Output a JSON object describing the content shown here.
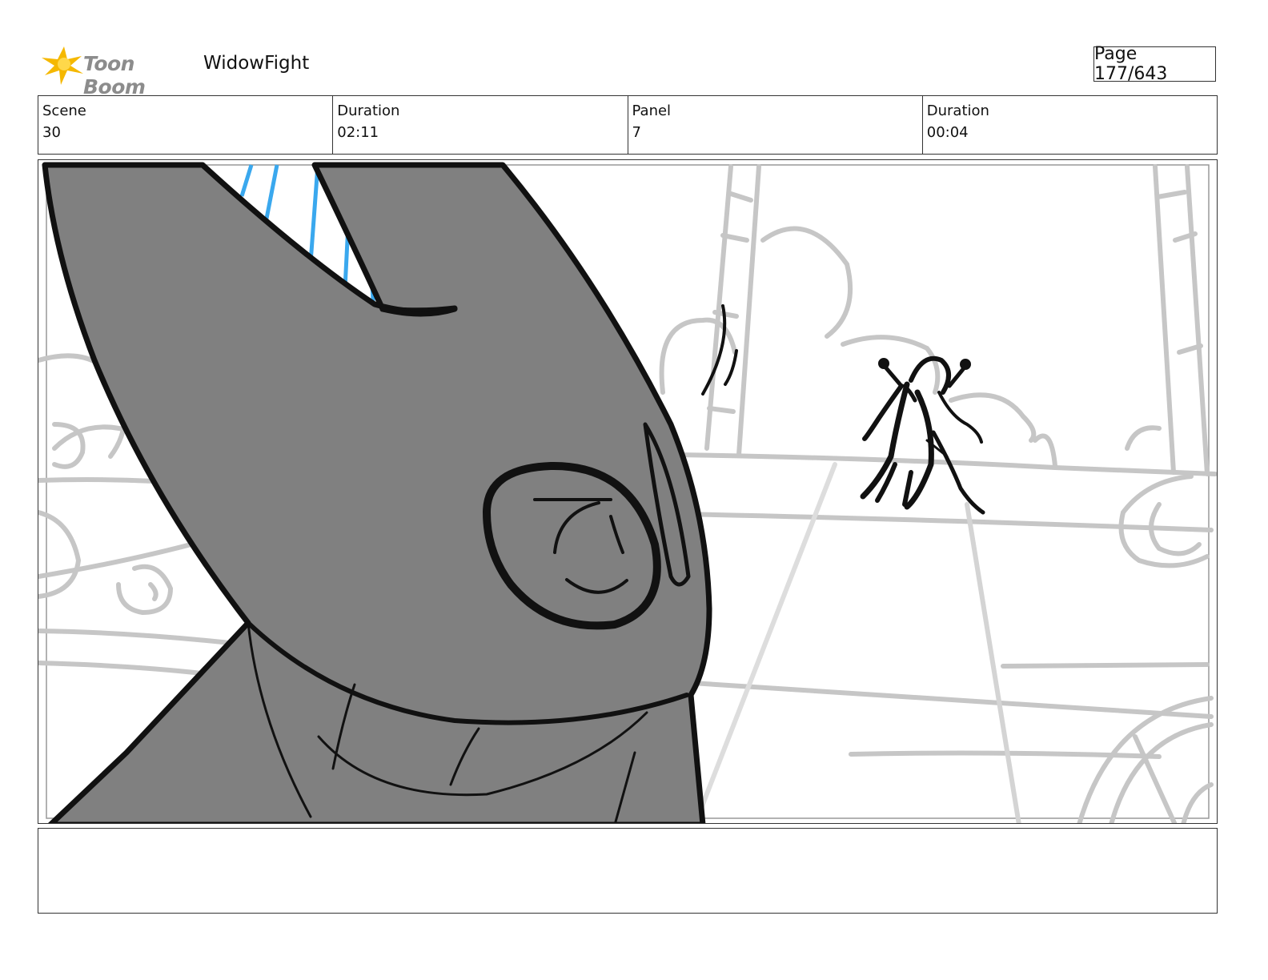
{
  "header": {
    "logo_text": "Toon Boom",
    "project_title": "WidowFight",
    "page_number": "Page 177/643"
  },
  "info": {
    "scene_label": "Scene",
    "scene_value": "30",
    "scene_duration_label": "Duration",
    "scene_duration_value": "02:11",
    "panel_label": "Panel",
    "panel_value": "7",
    "panel_duration_label": "Duration",
    "panel_duration_value": "00:04"
  },
  "colors": {
    "logo_star": "#f5b800",
    "character_fill": "#808080",
    "accent_blue": "#3aa8ee",
    "background_sketch": "#c4c4c4"
  },
  "notes": {
    "text": ""
  }
}
